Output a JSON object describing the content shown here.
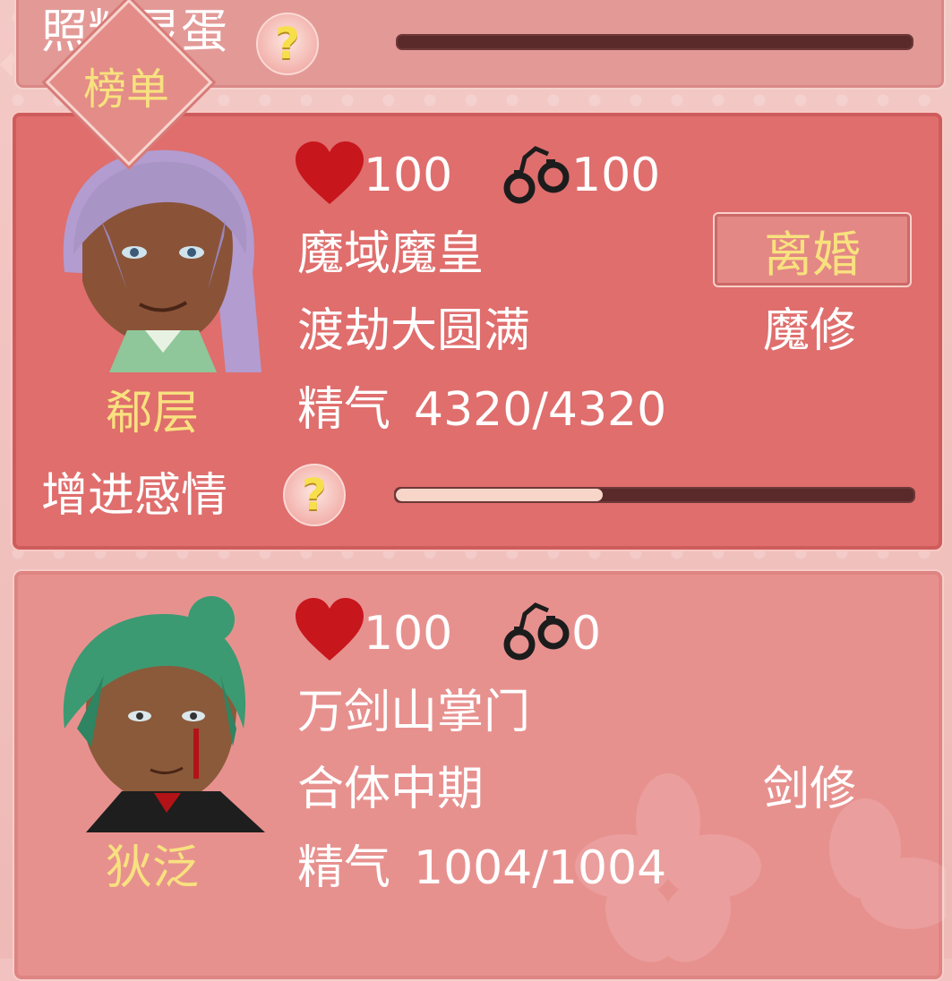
{
  "leaderboard_badge": "榜单",
  "top_card": {
    "label": "照料灵蛋",
    "help": "?",
    "progress": 0.0
  },
  "characters": [
    {
      "name": "郗层",
      "affection": "100",
      "bond": "100",
      "title": "魔域魔皇",
      "realm": "渡劫大圆满",
      "cultivation_path": "魔修",
      "essence_label": "精气",
      "essence_value": "4320/4320",
      "action_button": "离婚",
      "bottom_label": "增进感情",
      "help": "?",
      "progress": 0.4
    },
    {
      "name": "狄泛",
      "affection": "100",
      "bond": "0",
      "title": "万剑山掌门",
      "realm": "合体中期",
      "cultivation_path": "剑修",
      "essence_label": "精气",
      "essence_value": "1004/1004"
    }
  ],
  "icons": {
    "affection": "heart-icon",
    "bond": "handcuffs-icon",
    "help": "question-mark-icon"
  },
  "colors": {
    "heart": "#c8161d",
    "gold": "#f8e17e",
    "card_active": "#df6e6d",
    "card": "#e7918f"
  }
}
